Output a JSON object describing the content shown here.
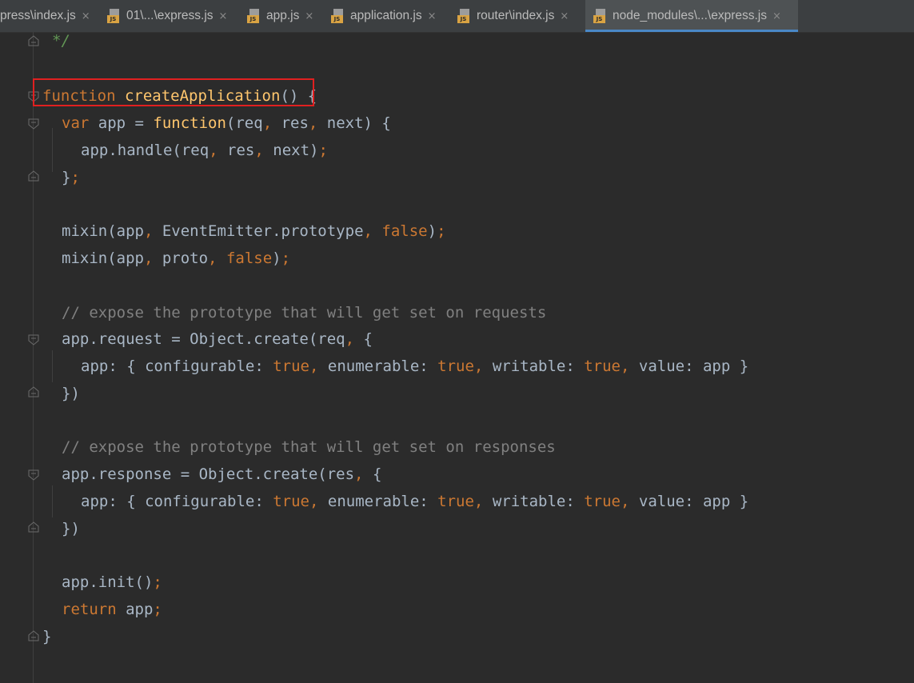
{
  "tabs": [
    {
      "label": "press\\index.js",
      "has_icon": false,
      "active": false
    },
    {
      "label": "01\\...\\express.js",
      "has_icon": true,
      "active": false
    },
    {
      "label": "app.js",
      "has_icon": true,
      "active": false
    },
    {
      "label": "application.js",
      "has_icon": true,
      "active": false
    },
    {
      "label": "router\\index.js",
      "has_icon": true,
      "active": false
    },
    {
      "label": "node_modules\\...\\express.js",
      "has_icon": true,
      "active": true
    }
  ],
  "tab_close_glyph": "×",
  "js_badge": "JS",
  "code": {
    "l1": "*/",
    "l2_kw": "function",
    "l2_fn": "createApplication",
    "l2_rest": "() {",
    "l3_kw1": "var",
    "l3_a": " app = ",
    "l3_kw2": "function",
    "l3_b": "(req",
    "l3_c": " res",
    "l3_d": " next) {",
    "l4_a": "app.handle(req",
    "l4_b": " res",
    "l4_c": " next)",
    "l5": "}",
    "l6_a": "mixin(app",
    "l6_b": " EventEmitter.prototype",
    "l6_c": "false",
    "l6_d": ")",
    "l7_a": "mixin(app",
    "l7_b": " proto",
    "l7_c": "false",
    "l7_d": ")",
    "l8": "// expose the prototype that will get set on requests",
    "l9_a": "app.request = Object.create(req",
    "l9_b": " {",
    "l10_a": "app: { configurable: ",
    "l10_t1": "true",
    "l10_b": " enumerable: ",
    "l10_t2": "true",
    "l10_c": " writable: ",
    "l10_t3": "true",
    "l10_d": " value: app }",
    "l11": "})",
    "l12": "// expose the prototype that will get set on responses",
    "l13_a": "app.response = Object.create(res",
    "l13_b": " {",
    "l14_a": "app: { configurable: ",
    "l14_t1": "true",
    "l14_b": " enumerable: ",
    "l14_t2": "true",
    "l14_c": " writable: ",
    "l14_t3": "true",
    "l14_d": " value: app }",
    "l15": "})",
    "l16_a": "app.init()",
    "l17_kw": "return",
    "l17_a": " app",
    "l18": "}",
    "comma": ",",
    "semi": ";"
  },
  "colors": {
    "background": "#2b2b2b",
    "keyword": "#cc7832",
    "function_name": "#ffc66d",
    "comment": "#808080",
    "text": "#a9b7c6",
    "highlight_box": "#e02020"
  }
}
